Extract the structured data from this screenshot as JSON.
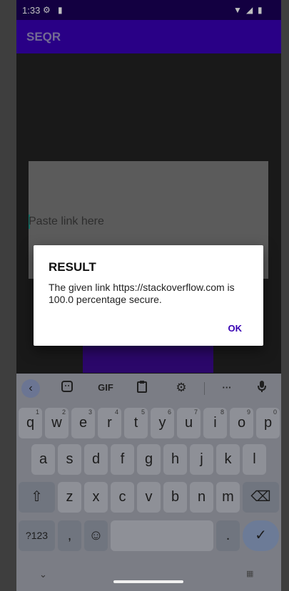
{
  "status_bar": {
    "time": "1:33",
    "icons": [
      "settings-icon",
      "sd-card-icon",
      "wifi-icon",
      "signal-icon",
      "battery-icon"
    ]
  },
  "app_bar": {
    "title": "SEQR"
  },
  "input": {
    "placeholder": "Paste link here"
  },
  "dialog": {
    "title": "RESULT",
    "message": "The given link https://stackoverflow.com is 100.0 percentage secure.",
    "ok_label": "OK"
  },
  "keyboard": {
    "toolbar": {
      "gif_label": "GIF",
      "icons": [
        "back-icon",
        "sticker-icon",
        "gif-icon",
        "clipboard-icon",
        "settings-icon",
        "more-icon",
        "mic-icon"
      ]
    },
    "row1": [
      "q",
      "w",
      "e",
      "r",
      "t",
      "y",
      "u",
      "i",
      "o",
      "p"
    ],
    "row1_numbers": [
      "1",
      "2",
      "3",
      "4",
      "5",
      "6",
      "7",
      "8",
      "9",
      "0"
    ],
    "row2": [
      "a",
      "s",
      "d",
      "f",
      "g",
      "h",
      "j",
      "k",
      "l"
    ],
    "row3": [
      "z",
      "x",
      "c",
      "v",
      "b",
      "n",
      "m"
    ],
    "symbols_label": "?123",
    "comma_label": ",",
    "period_label": "."
  },
  "colors": {
    "app_bar": "#3700b3",
    "status_bar": "#1a0057",
    "dialog_accent": "#3700b3"
  }
}
